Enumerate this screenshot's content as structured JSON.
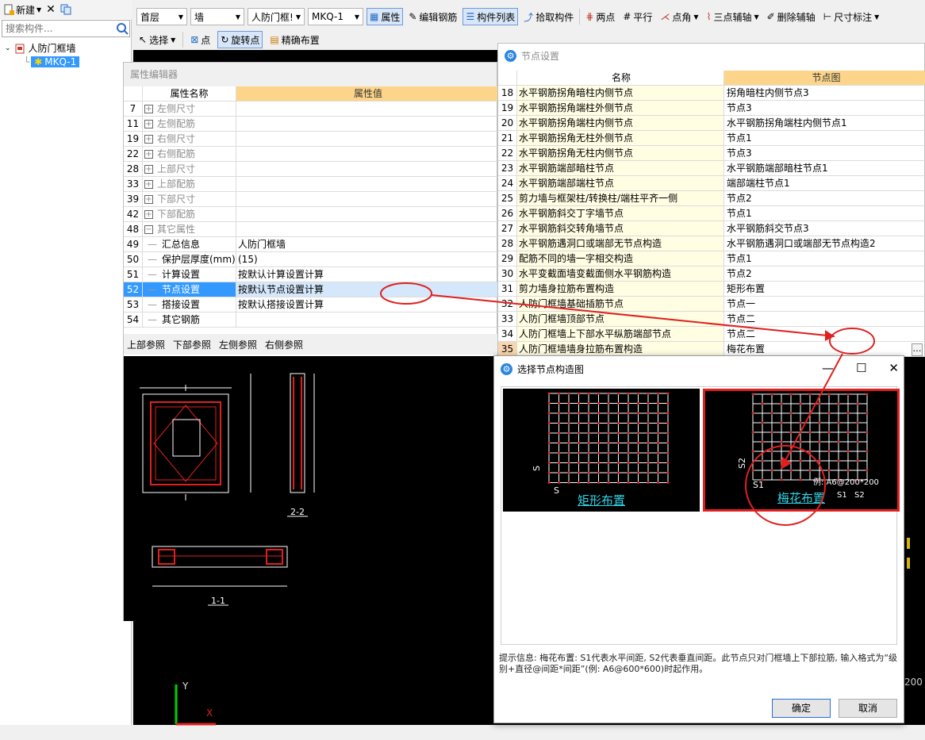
{
  "left_panel": {
    "new_label": "新建",
    "search_placeholder": "搜索构件...",
    "tree_root": "人防门框墙",
    "tree_child": "MKQ-1"
  },
  "toolbar": {
    "floor": "首层",
    "category": "墙",
    "type": "人防门框!",
    "name": "MKQ-1",
    "property": "属性",
    "edit_rebar": "编辑钢筋",
    "component_list": "构件列表",
    "pick_component": "拾取构件",
    "two_points": "两点",
    "parallel": "平行",
    "point_angle": "点角",
    "three_point_axis": "三点辅轴",
    "delete_axis": "删除辅轴",
    "dimension": "尺寸标注",
    "select": "选择",
    "point": "点",
    "rotate_point": "旋转点",
    "precise_layout": "精确布置"
  },
  "property_editor": {
    "title": "属性编辑器",
    "col_name": "属性名称",
    "col_value": "属性值",
    "rows": [
      {
        "n": "7",
        "k": "左侧尺寸",
        "v": "",
        "exp": "+"
      },
      {
        "n": "11",
        "k": "左侧配筋",
        "v": "",
        "exp": "+"
      },
      {
        "n": "19",
        "k": "右侧尺寸",
        "v": "",
        "exp": "+"
      },
      {
        "n": "22",
        "k": "右侧配筋",
        "v": "",
        "exp": "+"
      },
      {
        "n": "28",
        "k": "上部尺寸",
        "v": "",
        "exp": "+"
      },
      {
        "n": "33",
        "k": "上部配筋",
        "v": "",
        "exp": "+"
      },
      {
        "n": "39",
        "k": "下部尺寸",
        "v": "",
        "exp": "+"
      },
      {
        "n": "42",
        "k": "下部配筋",
        "v": "",
        "exp": "+"
      },
      {
        "n": "48",
        "k": "其它属性",
        "v": "",
        "exp": "−"
      },
      {
        "n": "49",
        "k": "汇总信息",
        "v": "人防门框墙",
        "exp": ""
      },
      {
        "n": "50",
        "k": "保护层厚度(mm)",
        "v": "(15)",
        "exp": ""
      },
      {
        "n": "51",
        "k": "计算设置",
        "v": "按默认计算设置计算",
        "exp": ""
      },
      {
        "n": "52",
        "k": "节点设置",
        "v": "按默认节点设置计算",
        "exp": ""
      },
      {
        "n": "53",
        "k": "搭接设置",
        "v": "按默认搭接设置计算",
        "exp": ""
      },
      {
        "n": "54",
        "k": "其它钢筋",
        "v": "",
        "exp": ""
      }
    ],
    "ref_tabs": [
      "上部参照",
      "下部参照",
      "左侧参照",
      "右侧参照"
    ],
    "drawing_labels": {
      "section_22": "2-2",
      "section_11": "1-1"
    }
  },
  "node_settings": {
    "title": "节点设置",
    "col_name": "名称",
    "col_value": "节点图",
    "rows": [
      {
        "n": "18",
        "k": "水平钢筋拐角暗柱内侧节点",
        "v": "拐角暗柱内侧节点3"
      },
      {
        "n": "19",
        "k": "水平钢筋拐角端柱外侧节点",
        "v": "节点3"
      },
      {
        "n": "20",
        "k": "水平钢筋拐角端柱内侧节点",
        "v": "水平钢筋拐角端柱内侧节点1"
      },
      {
        "n": "21",
        "k": "水平钢筋拐角无柱外侧节点",
        "v": "节点1"
      },
      {
        "n": "22",
        "k": "水平钢筋拐角无柱内侧节点",
        "v": "节点3"
      },
      {
        "n": "23",
        "k": "水平钢筋端部暗柱节点",
        "v": "水平钢筋端部暗柱节点1"
      },
      {
        "n": "24",
        "k": "水平钢筋端部端柱节点",
        "v": "端部端柱节点1"
      },
      {
        "n": "25",
        "k": "剪力墙与框架柱/转换柱/端柱平齐一侧",
        "v": "节点2"
      },
      {
        "n": "26",
        "k": "水平钢筋斜交丁字墙节点",
        "v": "节点1"
      },
      {
        "n": "27",
        "k": "水平钢筋斜交转角墙节点",
        "v": "水平钢筋斜交节点3"
      },
      {
        "n": "28",
        "k": "水平钢筋遇洞口或端部无节点构造",
        "v": "水平钢筋遇洞口或端部无节点构造2"
      },
      {
        "n": "29",
        "k": "配筋不同的墙一字相交构造",
        "v": "节点1"
      },
      {
        "n": "30",
        "k": "水平变截面墙变截面侧水平钢筋构造",
        "v": "节点2"
      },
      {
        "n": "31",
        "k": "剪力墙身拉筋布置构造",
        "v": "矩形布置"
      },
      {
        "n": "32",
        "k": "人防门框墙基础插筋节点",
        "v": "节点一"
      },
      {
        "n": "33",
        "k": "人防门框墙顶部节点",
        "v": "节点二"
      },
      {
        "n": "34",
        "k": "人防门框墙上下部水平纵筋端部节点",
        "v": "节点二"
      },
      {
        "n": "35",
        "k": "人防门框墙墙身拉筋布置构造",
        "v": "梅花布置"
      }
    ]
  },
  "choose_dialog": {
    "title": "选择节点构造图",
    "option1": "矩形布置",
    "option2": "梅花布置",
    "example": "例: A6@200*200",
    "s1": "S1",
    "s2": "S2",
    "s_label": "S",
    "hint": "提示信息:  梅花布置: S1代表水平间距, S2代表垂直间距。此节点只对门框墙上下部拉筋, 输入格式为“级别+直径@间距*间距”(例: A6@600*600)时起作用。",
    "ok": "确定",
    "cancel": "取消"
  },
  "canvas": {
    "axis_y": "Y",
    "axis_x": "X",
    "edge_num": "200"
  },
  "colors": {
    "selected_row": "#3399ff",
    "header_orange": "#fcd58a",
    "highlight_red": "#e02020",
    "link_cyan": "#2fd6e8"
  }
}
